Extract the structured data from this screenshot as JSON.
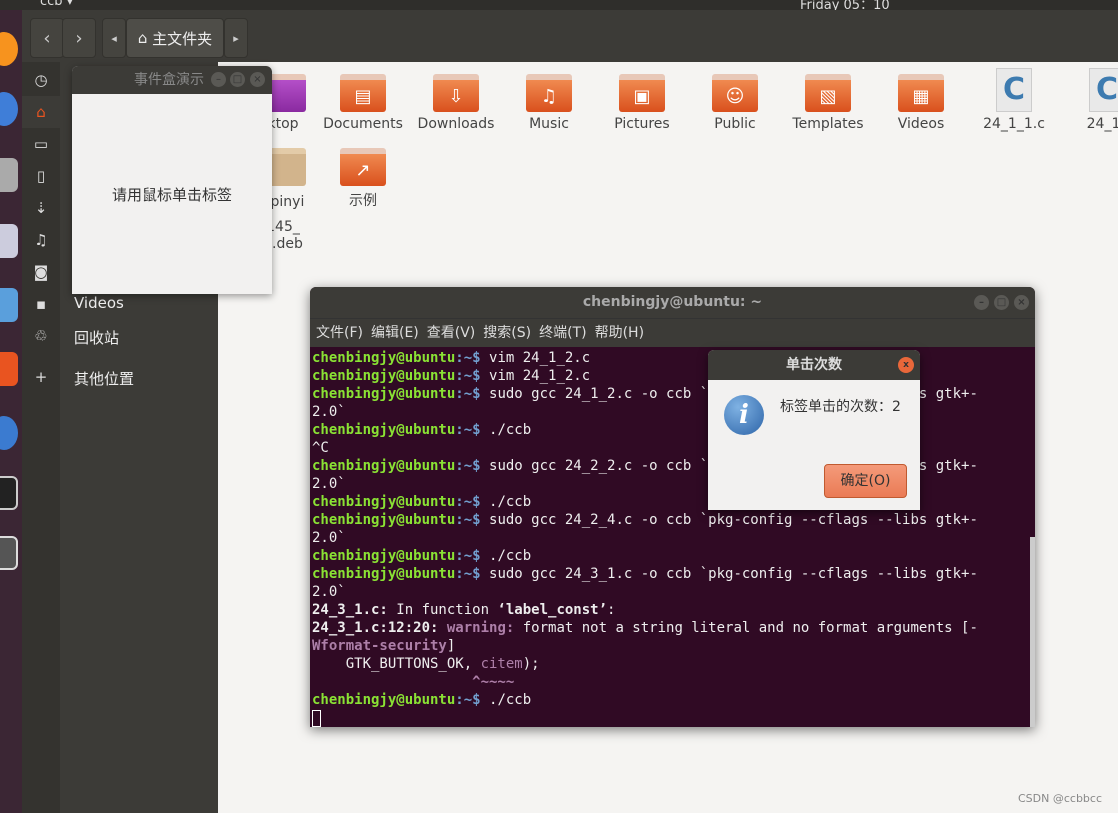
{
  "topbar": {
    "app": "ccb ▾",
    "clock": "Friday 05：10"
  },
  "header": {
    "back": "‹",
    "forward": "›",
    "path_left": "◂",
    "path_right": "▸",
    "home_label": "主文件夹"
  },
  "sidebar": {
    "items": [
      {
        "icon": "recent-icon",
        "label": ""
      },
      {
        "icon": "home-icon",
        "label": ""
      },
      {
        "icon": "folder-icon",
        "label": ""
      },
      {
        "icon": "document-icon",
        "label": ""
      },
      {
        "icon": "download-icon",
        "label": ""
      },
      {
        "icon": "music-icon",
        "label": ""
      },
      {
        "icon": "camera-icon",
        "label": ""
      },
      {
        "icon": "video-icon",
        "label": "Videos"
      },
      {
        "icon": "trash-icon",
        "label": "回收站"
      },
      {
        "icon": "plus-icon",
        "label": "其他位置"
      }
    ]
  },
  "files": {
    "row1": [
      "ktop",
      "Documents",
      "Downloads",
      "Music",
      "Pictures",
      "Public",
      "Templates",
      "Videos",
      "24_1_1.c",
      "24_1_"
    ],
    "row2a": "upinyi",
    "row2b": "145_",
    "row2c": "4.deb",
    "example": "示例"
  },
  "event_window": {
    "title": "事件盒演示",
    "label": "请用鼠标单击标签"
  },
  "terminal": {
    "title": "chenbingjy@ubuntu: ~",
    "menu": [
      "文件(F)",
      "编辑(E)",
      "查看(V)",
      "搜索(S)",
      "终端(T)",
      "帮助(H)"
    ],
    "prompt": "chenbingjy@ubuntu",
    "path": ":~$ ",
    "lines": [
      {
        "p": true,
        "t": "vim 24_1_2.c"
      },
      {
        "p": true,
        "t": "vim 24_1_2.c"
      },
      {
        "p": true,
        "t": "sudo gcc 24_1_2.c -o ccb `pkg-config --cflags --libs gtk+-"
      },
      {
        "p": false,
        "t": "2.0`"
      },
      {
        "p": true,
        "t": "./ccb"
      },
      {
        "p": false,
        "t": "^C"
      },
      {
        "p": true,
        "t": "sudo gcc 24_2_2.c -o ccb `pkg-config --cflags --libs gtk+-"
      },
      {
        "p": false,
        "t": "2.0`"
      },
      {
        "p": true,
        "t": "./ccb"
      },
      {
        "p": true,
        "t": "sudo gcc 24_2_4.c -o ccb `pkg-config --cflags --libs gtk+-"
      },
      {
        "p": false,
        "t": "2.0`"
      },
      {
        "p": true,
        "t": "./ccb"
      },
      {
        "p": true,
        "t": "sudo gcc 24_3_1.c -o ccb `pkg-config --cflags --libs gtk+-"
      },
      {
        "p": false,
        "t": "2.0`"
      }
    ],
    "fn_file": "24_3_1.c:",
    "fn_text": " In function ",
    "fn_name": "‘label_const’",
    "fn_end": ":",
    "warn_loc": "24_3_1.c:12:20:",
    "warn_kw": " warning:",
    "warn_text": " format not a string literal and no format arguments [-",
    "warn_flag": "Wformat-security",
    "warn_close": "]",
    "src_pre": "    GTK_BUTTONS_OK, ",
    "src_hl": "citem",
    "src_post": ");",
    "caret": "                   ^~~~~",
    "last_cmd": "./ccb"
  },
  "dialog": {
    "title": "单击次数",
    "message": "标签单击的次数：2",
    "ok": "确定(O)",
    "close": "x"
  },
  "watermark": "CSDN @ccbbcc"
}
